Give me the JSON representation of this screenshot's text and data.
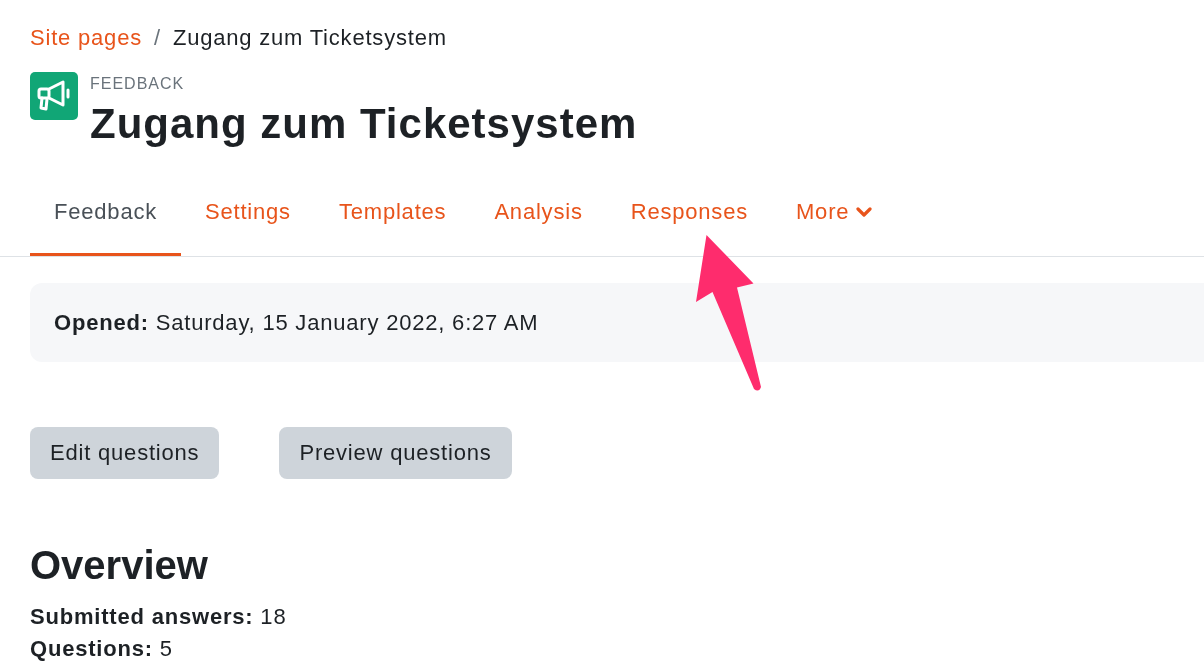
{
  "breadcrumb": {
    "separator": "/",
    "items": [
      {
        "label": "Site pages",
        "kind": "link"
      },
      {
        "label": "Zugang zum Ticketsystem",
        "kind": "current"
      }
    ]
  },
  "header": {
    "module_label": "FEEDBACK",
    "title": "Zugang zum Ticketsystem"
  },
  "tabs": [
    {
      "label": "Feedback",
      "selected": true,
      "kind": "link"
    },
    {
      "label": "Settings",
      "selected": false,
      "kind": "link"
    },
    {
      "label": "Templates",
      "selected": false,
      "kind": "link"
    },
    {
      "label": "Analysis",
      "selected": false,
      "kind": "link"
    },
    {
      "label": "Responses",
      "selected": false,
      "kind": "link"
    },
    {
      "label": "More",
      "selected": false,
      "kind": "dropdown"
    }
  ],
  "info": {
    "text": "**Opened:** Saturday, 15 January 2022, 6:27 AM"
  },
  "buttons": [
    "Edit questions",
    "Preview questions"
  ],
  "overview": {
    "title": "Overview",
    "stats": [
      "**Submitted answers:** 18",
      "**Questions:** 5"
    ]
  }
}
